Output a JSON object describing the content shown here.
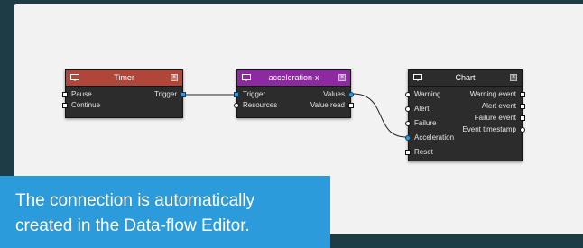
{
  "nodes": {
    "timer": {
      "title": "Timer",
      "header_color": "#b0463a",
      "inputs": [
        "Pause",
        "Continue"
      ],
      "outputs": [
        "Trigger"
      ]
    },
    "acceleration": {
      "title": "acceleration-x",
      "header_color": "#8e2aa1",
      "inputs": [
        "Trigger",
        "Resources"
      ],
      "outputs": [
        "Values",
        "Value read"
      ]
    },
    "chart": {
      "title": "Chart",
      "header_color": "#2c2c2c",
      "inputs": [
        "Warning",
        "Alert",
        "Failure",
        "Acceleration",
        "Reset"
      ],
      "outputs": [
        "Warning event",
        "Alert event",
        "Failure event",
        "Event timestamp"
      ]
    }
  },
  "connections": [
    {
      "from": "Timer.Trigger",
      "to": "acceleration-x.Trigger"
    },
    {
      "from": "acceleration-x.Values",
      "to": "Chart.Acceleration"
    }
  ],
  "tooltip": {
    "line1": "The connection is automatically",
    "line2": "created in the Data-flow Editor."
  },
  "colors": {
    "background": "#1e3c46",
    "canvas": "#f2f2f2",
    "node_body": "#2c2c2c",
    "port_linked": "#2b9bdc",
    "tooltip": "#2b9bdc"
  }
}
